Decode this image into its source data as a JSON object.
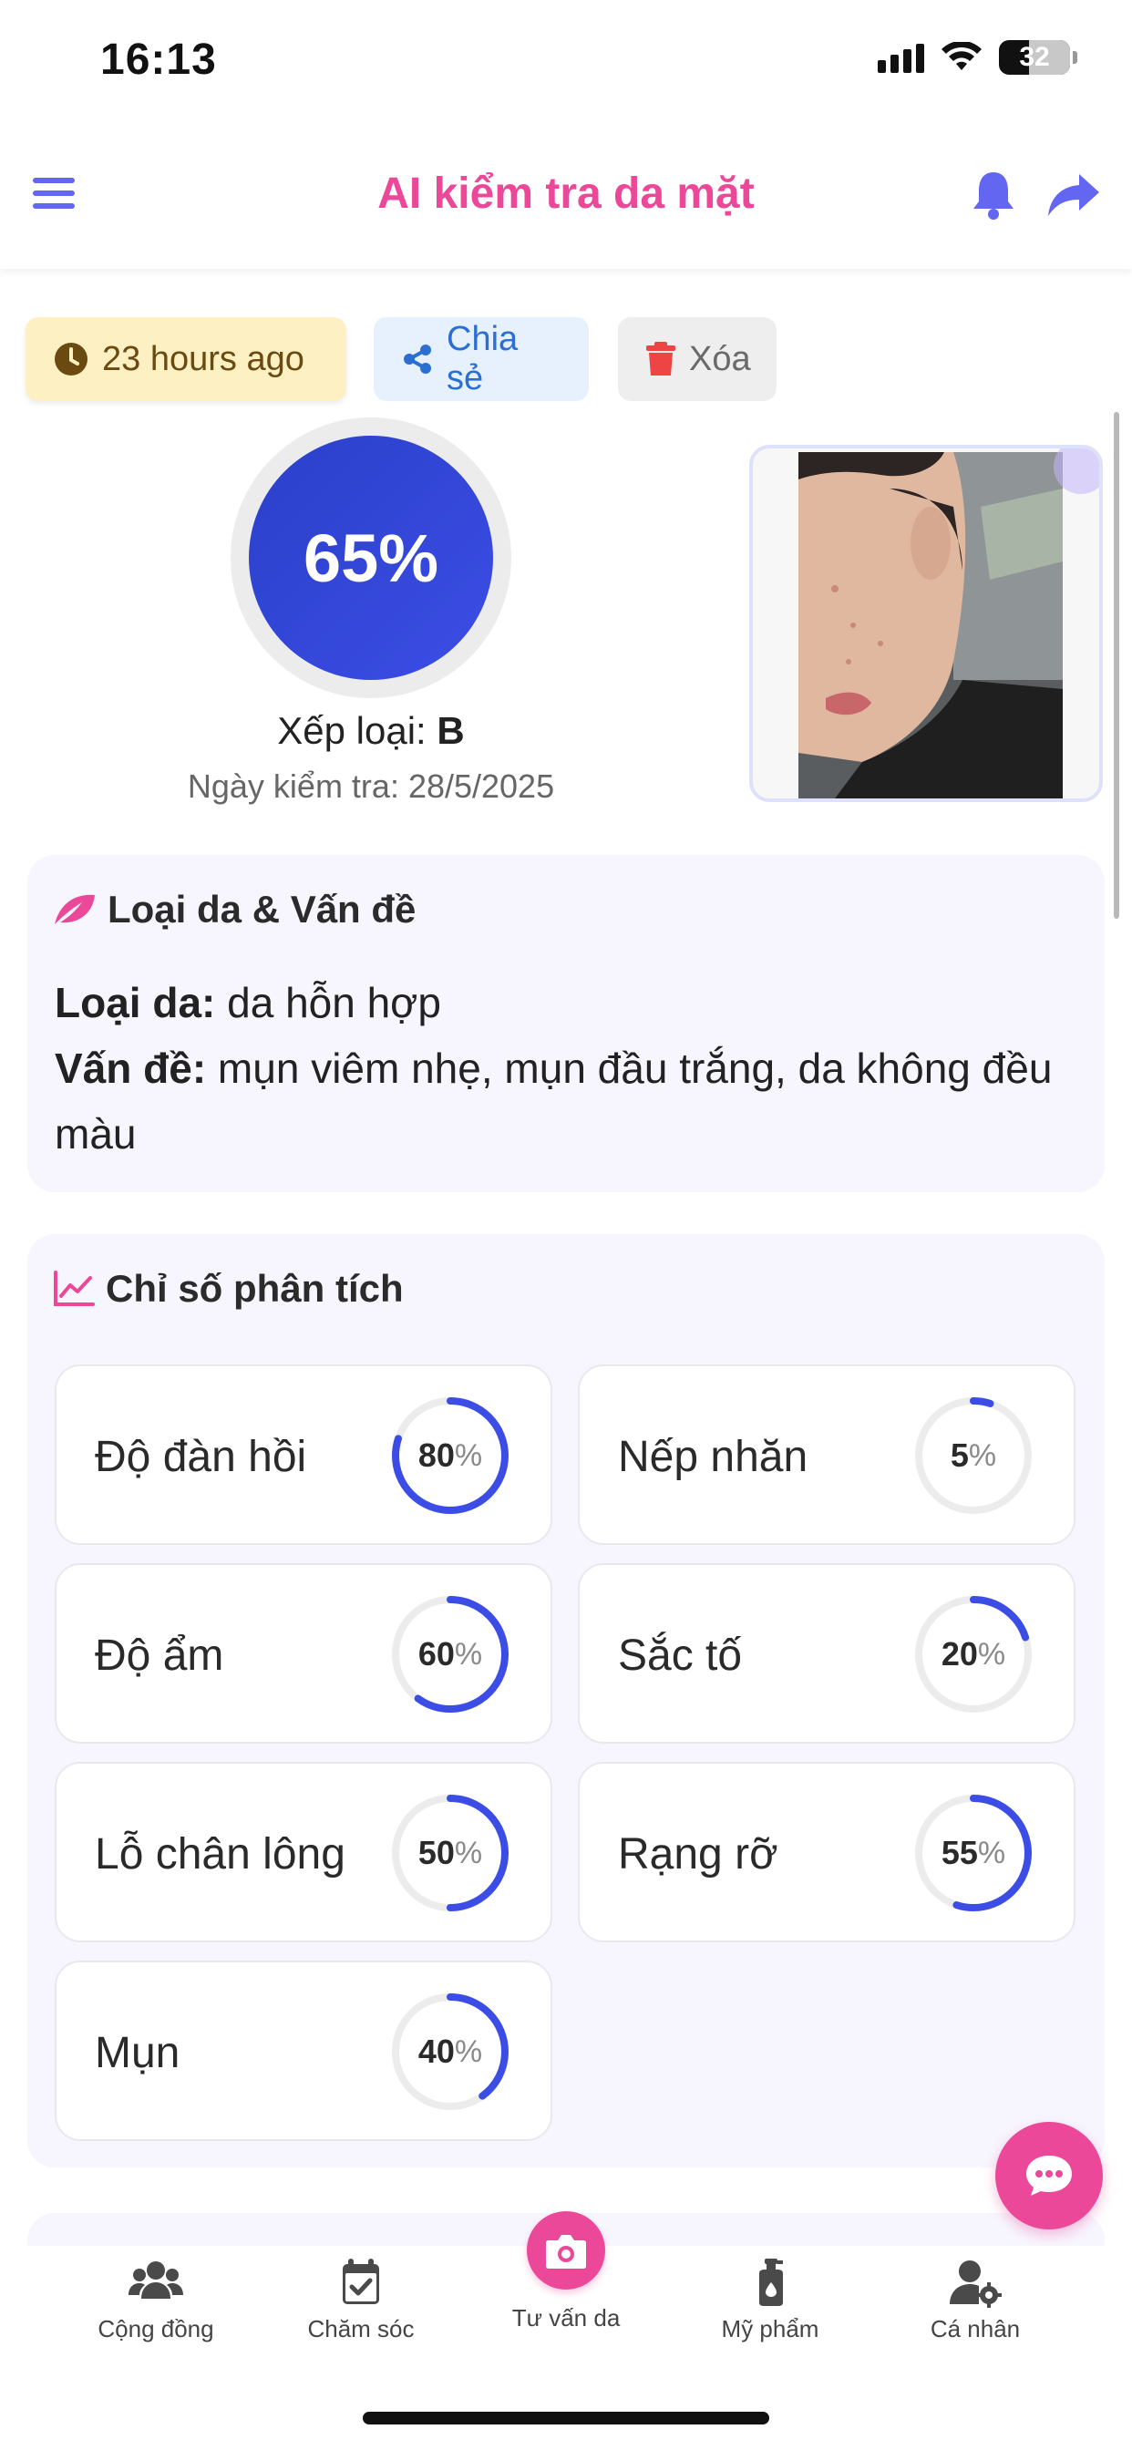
{
  "status_bar": {
    "time": "16:13",
    "battery": "32"
  },
  "header": {
    "title": "AI kiểm tra da mặt",
    "menu_icon": "hamburger-icon",
    "bell_icon": "bell-icon",
    "share_icon": "share-arrow-icon"
  },
  "actions": {
    "time_label": "23 hours ago",
    "share_label": "Chia sẻ",
    "delete_label": "Xóa"
  },
  "colors": {
    "accent_pink": "#ec4899",
    "accent_blue": "#3c4de6",
    "ring_track": "#ececec"
  },
  "score": {
    "value": "65%",
    "grade_prefix": "Xếp loại: ",
    "grade": "B",
    "date_label": "Ngày kiểm tra: 28/5/2025"
  },
  "skin": {
    "title": "Loại da & Vấn đề",
    "type_label": "Loại da:",
    "type_value": " da hỗn hợp",
    "issues_label": "Vấn đề:",
    "issues_value": " mụn viêm nhẹ, mụn đầu trắng, da không đều màu"
  },
  "metrics": {
    "title": "Chỉ số phân tích",
    "percent_sign": "%",
    "items": [
      {
        "label": "Độ đàn hồi",
        "value": 80
      },
      {
        "label": "Nếp nhăn",
        "value": 5
      },
      {
        "label": "Độ ẩm",
        "value": 60
      },
      {
        "label": "Sắc tố",
        "value": 20
      },
      {
        "label": "Lỗ chân lông",
        "value": 50
      },
      {
        "label": "Rạng rỡ",
        "value": 55
      },
      {
        "label": "Mụn",
        "value": 40
      }
    ]
  },
  "nav": {
    "items": [
      {
        "label": "Cộng đồng",
        "icon": "users-icon"
      },
      {
        "label": "Chăm sóc",
        "icon": "calendar-check-icon"
      },
      {
        "label": "Tư vấn da",
        "icon": "camera-icon"
      },
      {
        "label": "Mỹ phẩm",
        "icon": "bottle-icon"
      },
      {
        "label": "Cá nhân",
        "icon": "user-gear-icon"
      }
    ]
  }
}
